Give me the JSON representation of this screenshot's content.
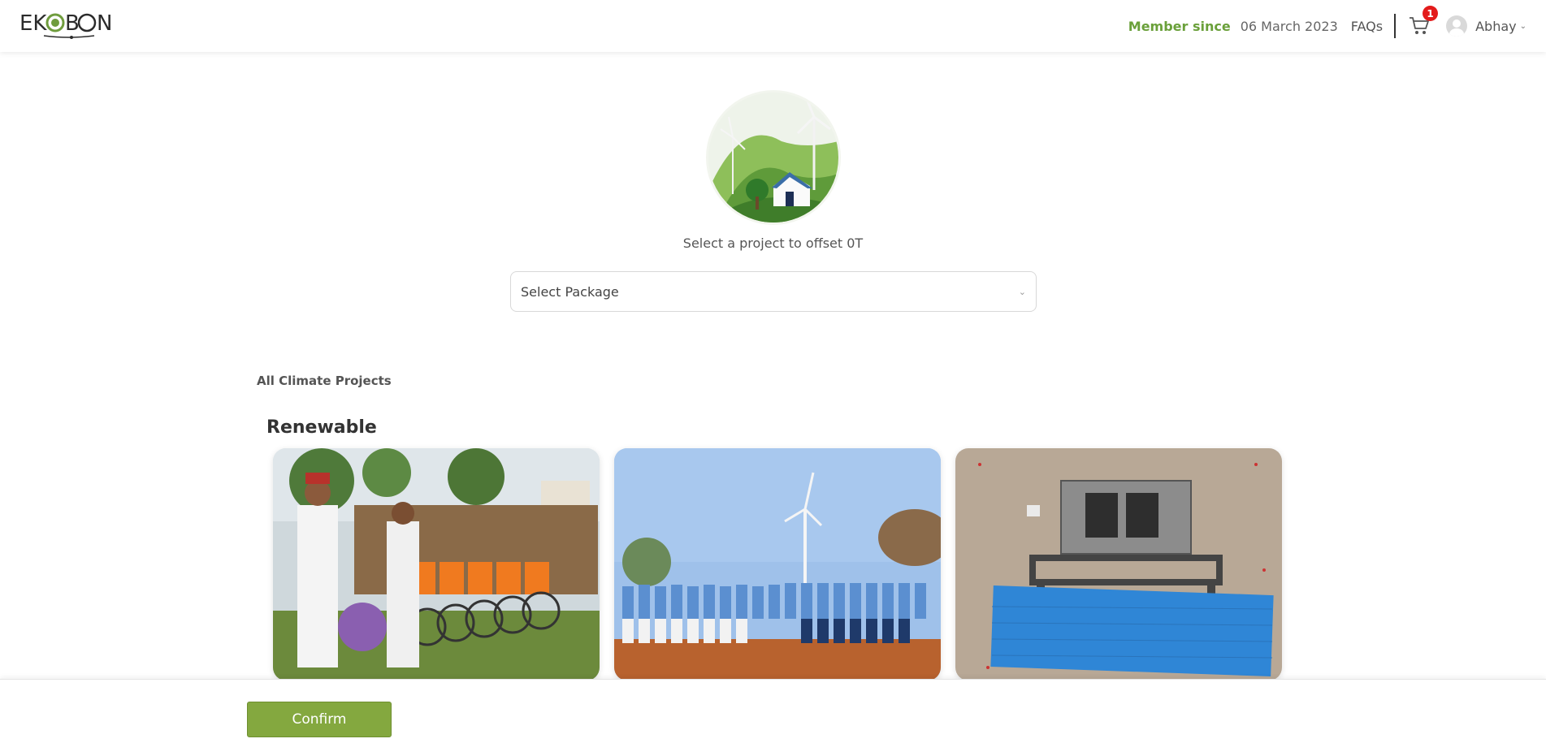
{
  "header": {
    "logo_text": "EKOBON",
    "member_since_label": "Member since",
    "member_since_date": "06 March 2023",
    "faqs_label": "FAQs",
    "cart_count": "1",
    "user_name": "Abhay"
  },
  "main": {
    "offset_text": "Select a project to offset 0T",
    "package_select": {
      "selected": "Select Package"
    },
    "all_projects_label": "All Climate Projects",
    "section_title": "Renewable",
    "cards": [
      {
        "image": "bicycles-distribution-photo"
      },
      {
        "image": "wind-turbine-students-photo"
      },
      {
        "image": "solar-plant-aerial-photo"
      }
    ]
  },
  "footer": {
    "confirm_label": "Confirm"
  },
  "colors": {
    "accent_green": "#84a83f",
    "member_since_green": "#6aa03a",
    "badge_red": "#e31b1b"
  }
}
